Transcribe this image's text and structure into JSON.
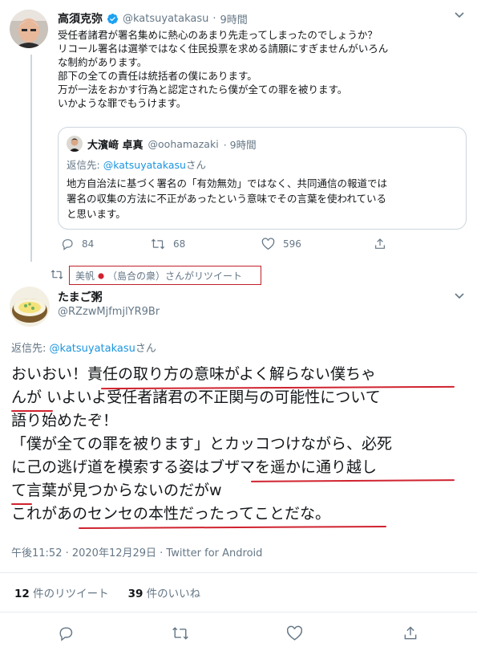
{
  "tweet1": {
    "name": "高須克弥",
    "handle": "@katsuyatakasu",
    "dot": "·",
    "time": "9時間",
    "lines": [
      "受任者諸君が署名集めに熱心のあまり先走ってしまったのでしょうか？",
      "リコール署名は選挙ではなく住民投票を求める請願にすぎませんがいろん",
      "な制約があります。",
      "部下の全ての責任は統括者の僕にあります。",
      "万が一法をおかす行為と認定されたら僕が全ての罪を被ります。",
      "いかような罪でもうけます。"
    ],
    "quote": {
      "name": "大濱﨑 卓真",
      "handle": "@oohamazaki",
      "time": "· 9時間",
      "reply_prefix": "返信先: ",
      "reply_handle": "@katsuyatakasu",
      "reply_suffix": "さん",
      "lines": [
        "地方自治法に基づく署名の「有効無効」ではなく、共同通信の報道では",
        "署名の収集の方法に不正があったという意味でその言葉を使われている",
        "と思います。"
      ]
    },
    "replies": "84",
    "retweets": "68",
    "likes": "596"
  },
  "retweet_banner": {
    "prefix": "美帆",
    "suffix": "（島合の衆）さんがリツイート"
  },
  "tweet2": {
    "name": "たまご粥",
    "handle": "@RZzwMjfmjlYR9Br",
    "reply_prefix": "返信先: ",
    "reply_handle": "@katsuyatakasu",
    "reply_suffix": "さん",
    "lines": [
      "おいおい！責任の取り方の意味がよく解らない僕ちゃ",
      "んが いよいよ受任者諸君の不正関与の可能性について",
      "語り始めたぞ！",
      "「僕が全ての罪を被ります」とカッコつけながら、必死",
      "に己の逃げ道を模索する姿はブザマを遥かに通り越し",
      "て言葉が見つからないのだがw",
      "これがあのセンセの本性だったってことだな。"
    ],
    "timestamp": "午後11:52 · 2020年12月29日 · Twitter for Android",
    "rt_count": "12",
    "rt_label": " 件のリツイート",
    "like_count": "39",
    "like_label": " 件のいいね"
  },
  "colors": {
    "link": "#1b95e0",
    "secondary_text": "#657786",
    "underline": "#d0232f",
    "verified": "#1da1f2"
  },
  "icons": [
    "chevron-down-icon",
    "verified-icon",
    "reply-icon",
    "retweet-icon",
    "like-icon",
    "share-icon",
    "japan-flag-icon"
  ]
}
